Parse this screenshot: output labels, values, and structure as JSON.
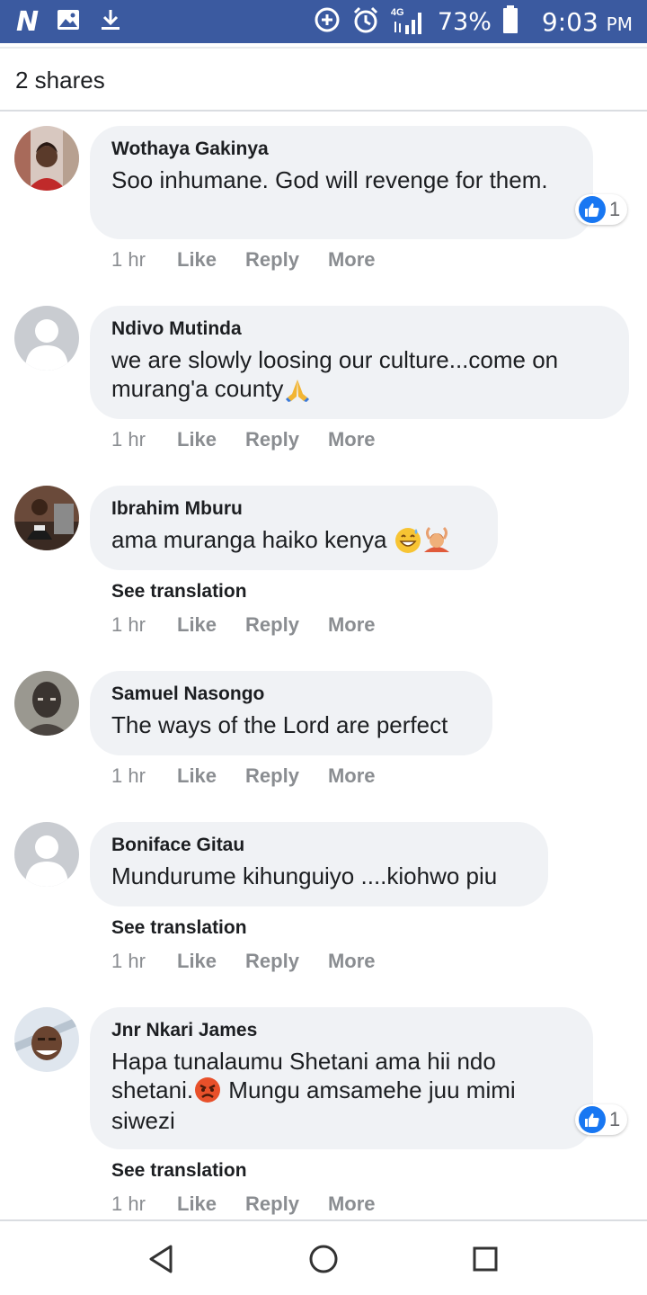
{
  "status_bar": {
    "signal_label": "4G",
    "battery": "73%",
    "time": "9:03",
    "time_suffix": "PM"
  },
  "post": {
    "shares": "2 shares"
  },
  "comments": [
    {
      "author": "Wothaya Gakinya",
      "text": "Soo inhumane. God will revenge for them.",
      "time": "1 hr",
      "like": "Like",
      "reply": "Reply",
      "more": "More",
      "reaction_count": "1"
    },
    {
      "author": "Ndivo Mutinda",
      "text": "we are slowly loosing our culture...come on murang'a county",
      "emoji": "🙏",
      "time": "1 hr",
      "like": "Like",
      "reply": "Reply",
      "more": "More"
    },
    {
      "author": "Ibrahim Mburu",
      "text": "ama muranga haiko kenya",
      "emoji": "😅🙆",
      "see_translation": "See translation",
      "time": "1 hr",
      "like": "Like",
      "reply": "Reply",
      "more": "More"
    },
    {
      "author": "Samuel Nasongo",
      "text": "The ways of the Lord are perfect",
      "time": "1 hr",
      "like": "Like",
      "reply": "Reply",
      "more": "More"
    },
    {
      "author": "Boniface Gitau",
      "text": "Mundurume kihunguiyo ....kiohwo piu",
      "see_translation": "See translation",
      "time": "1 hr",
      "like": "Like",
      "reply": "Reply",
      "more": "More"
    },
    {
      "author": "Jnr Nkari James",
      "text_part1": "Hapa tunalaumu Shetani ama hii ndo shetani.",
      "emoji": "😡",
      "text_part2": " Mungu amsamehe juu mimi siwezi",
      "see_translation": "See translation",
      "time": "1 hr",
      "like": "Like",
      "reply": "Reply",
      "more": "More",
      "reaction_count": "1"
    }
  ],
  "icons": {
    "status_left": [
      "n-app-icon",
      "image-icon",
      "download-icon"
    ],
    "status_right": [
      "data-saver-icon",
      "alarm-icon",
      "signal-icon",
      "battery-icon"
    ],
    "navigation": [
      "back-icon",
      "home-icon",
      "recents-icon"
    ],
    "reaction": "like-reaction-icon"
  },
  "colors": {
    "status_bar": "#3b5aa0",
    "bubble": "#f0f2f5",
    "like_blue": "#1877f2",
    "meta_gray": "#8a8d91"
  }
}
